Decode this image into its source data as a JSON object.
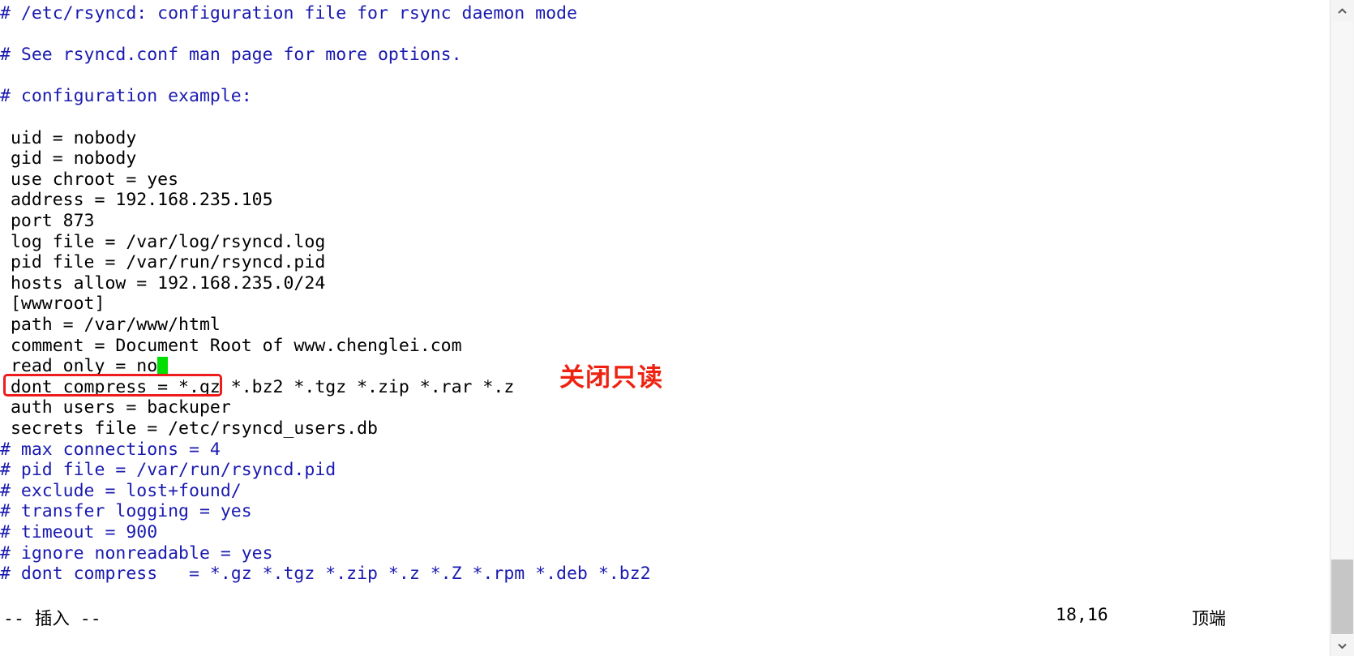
{
  "window": {
    "title": "/etc/rsyncd.conf",
    "background_color": "#ffffff",
    "comment_color": "#1a1ab0",
    "code_color": "#000000",
    "annotation_color": "#ee2211",
    "cursor_color": "#00e000"
  },
  "editor": {
    "lines": [
      {
        "kind": "comment",
        "text": "# /etc/rsyncd: configuration file for rsync daemon mode"
      },
      {
        "kind": "blank",
        "text": ""
      },
      {
        "kind": "comment",
        "text": "# See rsyncd.conf man page for more options."
      },
      {
        "kind": "blank",
        "text": ""
      },
      {
        "kind": "comment",
        "text": "# configuration example:"
      },
      {
        "kind": "blank",
        "text": ""
      },
      {
        "kind": "code",
        "text": " uid = nobody"
      },
      {
        "kind": "code",
        "text": " gid = nobody"
      },
      {
        "kind": "code",
        "text": " use chroot = yes"
      },
      {
        "kind": "code",
        "text": " address = 192.168.235.105"
      },
      {
        "kind": "code",
        "text": " port 873"
      },
      {
        "kind": "code",
        "text": " log file = /var/log/rsyncd.log"
      },
      {
        "kind": "code",
        "text": " pid file = /var/run/rsyncd.pid"
      },
      {
        "kind": "code",
        "text": " hosts allow = 192.168.235.0/24"
      },
      {
        "kind": "code",
        "text": " [wwwroot]"
      },
      {
        "kind": "code",
        "text": " path = /var/www/html"
      },
      {
        "kind": "code",
        "text": " comment = Document Root of www.chenglei.com"
      },
      {
        "kind": "cursorline",
        "text": " read only = no"
      },
      {
        "kind": "code",
        "text": " dont compress = *.gz *.bz2 *.tgz *.zip *.rar *.z"
      },
      {
        "kind": "code",
        "text": " auth users = backuper"
      },
      {
        "kind": "code",
        "text": " secrets file = /etc/rsyncd_users.db"
      },
      {
        "kind": "comment",
        "text": "# max connections = 4"
      },
      {
        "kind": "comment",
        "text": "# pid file = /var/run/rsyncd.pid"
      },
      {
        "kind": "comment",
        "text": "# exclude = lost+found/"
      },
      {
        "kind": "comment",
        "text": "# transfer logging = yes"
      },
      {
        "kind": "comment",
        "text": "# timeout = 900"
      },
      {
        "kind": "comment",
        "text": "# ignore nonreadable = yes"
      },
      {
        "kind": "comment",
        "text": "# dont compress   = *.gz *.tgz *.zip *.z *.Z *.rpm *.deb *.bz2"
      }
    ]
  },
  "annotations": {
    "highlight_label": "关闭只读",
    "highlight_target_text": " read only = no"
  },
  "statusline": {
    "mode": "-- 插入 --",
    "position": "18,16",
    "scroll_state": "顶端"
  },
  "scrollbar": {
    "up_arrow": "chevron-up",
    "down_arrow": "chevron-down"
  }
}
